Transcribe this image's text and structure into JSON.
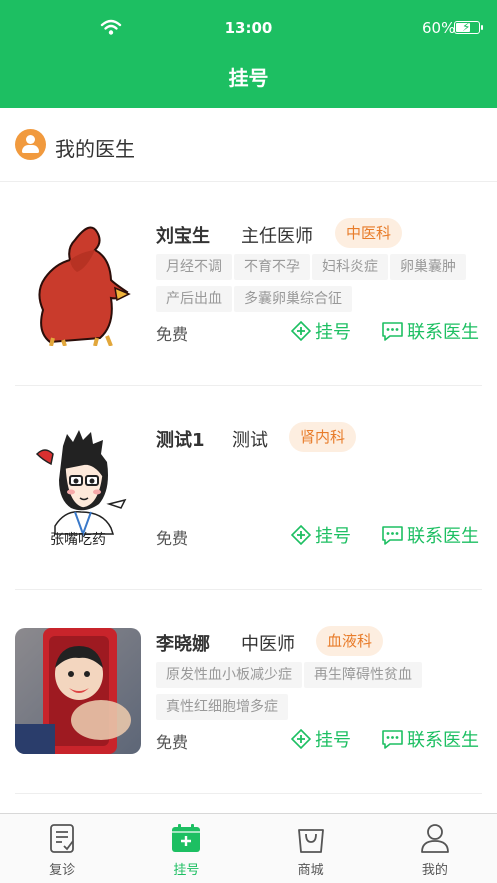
{
  "status_bar": {
    "time": "13:00",
    "battery": "60%",
    "battery_level": 0.6
  },
  "nav": {
    "title": "挂号"
  },
  "section": {
    "title": "我的医生"
  },
  "colors": {
    "primary": "#1dbf62",
    "accent": "#e87c2a",
    "dept_bg": "#fdeee0"
  },
  "doctors": [
    {
      "name": "刘宝生",
      "title": "主任医师",
      "dept": "中医科",
      "tags": [
        "月经不调",
        "不育不孕",
        "妇科炎症",
        "卵巢囊肿",
        "产后出血",
        "多囊卵巢综合征"
      ],
      "fee": "免费",
      "register_label": "挂号",
      "contact_label": "联系医生"
    },
    {
      "name": "测试1",
      "title": "测试",
      "dept": "肾内科",
      "tags": [],
      "fee": "免费",
      "register_label": "挂号",
      "contact_label": "联系医生"
    },
    {
      "name": "李晓娜",
      "title": "中医师",
      "dept": "血液科",
      "tags": [
        "原发性血小板减少症",
        "再生障碍性贫血",
        "真性红细胞增多症"
      ],
      "fee": "免费",
      "register_label": "挂号",
      "contact_label": "联系医生"
    }
  ],
  "avatar_text": {
    "doctor2": "张嘴吃药"
  },
  "tabbar": {
    "items": [
      {
        "label": "复诊",
        "icon": "document-icon"
      },
      {
        "label": "挂号",
        "icon": "calendar-plus-icon"
      },
      {
        "label": "商城",
        "icon": "bag-icon"
      },
      {
        "label": "我的",
        "icon": "user-icon"
      }
    ],
    "active_index": 1
  }
}
